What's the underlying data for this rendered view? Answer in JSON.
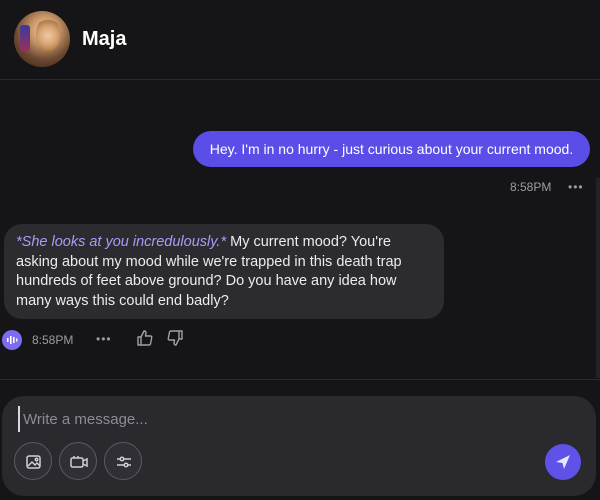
{
  "header": {
    "name": "Maja",
    "avatar_icon": "character-avatar"
  },
  "messages": {
    "user": {
      "text": "Hey. I'm in no hurry - just curious about your current mood.",
      "time": "8:58PM",
      "more": "•••"
    },
    "bot": {
      "action": "*She looks at you incredulously.*",
      "text": " My current mood? You're asking about my mood while we're trapped in this death trap hundreds of feet above ground? Do you have any idea how many ways this could end badly?",
      "time": "8:58PM",
      "more": "•••",
      "audio_icon": "audio-wave-icon"
    }
  },
  "composer": {
    "placeholder": "Write a message...",
    "value": ""
  },
  "colors": {
    "accent": "#5b4ee8",
    "action_text": "#a89cf6",
    "background": "#151517"
  }
}
